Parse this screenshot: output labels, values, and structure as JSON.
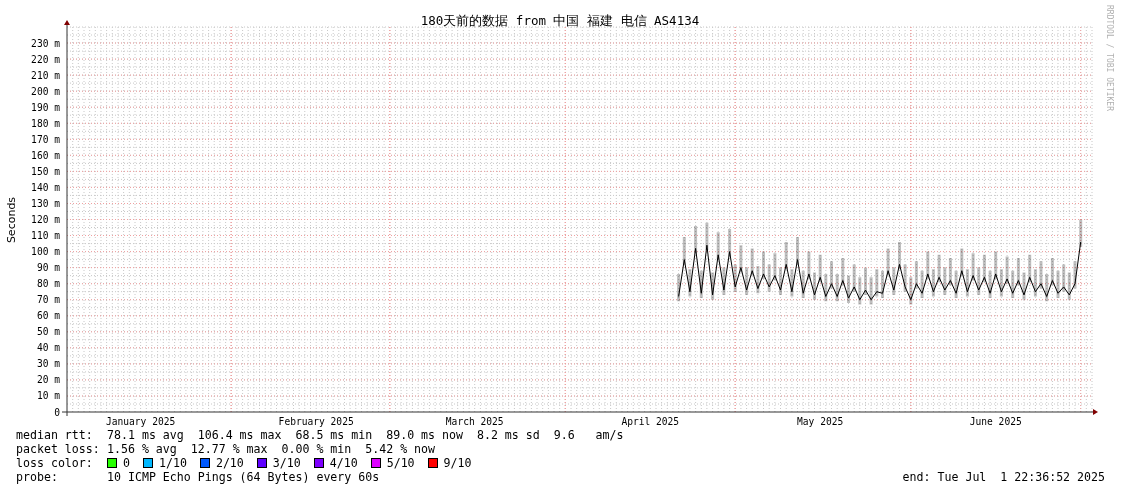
{
  "graph": {
    "credit": "RRDTOOL / TOBI OETIKER",
    "chart_data": {
      "type": "line",
      "title": "180天前的数据 from 中国 福建 电信 AS4134",
      "ylabel": "Seconds",
      "grid": true,
      "xlim": [
        "2025-01-03",
        "2025-07-03"
      ],
      "ylim": [
        0,
        240
      ],
      "xticks": [
        {
          "value": "2025-01-16",
          "label": "January 2025"
        },
        {
          "value": "2025-02-16",
          "label": "February 2025"
        },
        {
          "value": "2025-03-16",
          "label": "March 2025"
        },
        {
          "value": "2025-04-16",
          "label": "April 2025"
        },
        {
          "value": "2025-05-16",
          "label": "May 2025"
        },
        {
          "value": "2025-06-16",
          "label": "June 2025"
        }
      ],
      "yticks": [
        {
          "value": 0,
          "label": "0"
        },
        {
          "value": 10,
          "label": "10 m"
        },
        {
          "value": 20,
          "label": "20 m"
        },
        {
          "value": 30,
          "label": "30 m"
        },
        {
          "value": 40,
          "label": "40 m"
        },
        {
          "value": 50,
          "label": "50 m"
        },
        {
          "value": 60,
          "label": "60 m"
        },
        {
          "value": 70,
          "label": "70 m"
        },
        {
          "value": 80,
          "label": "80 m"
        },
        {
          "value": 90,
          "label": "90 m"
        },
        {
          "value": 100,
          "label": "100 m"
        },
        {
          "value": 110,
          "label": "110 m"
        },
        {
          "value": 120,
          "label": "120 m"
        },
        {
          "value": 130,
          "label": "130 m"
        },
        {
          "value": 140,
          "label": "140 m"
        },
        {
          "value": 150,
          "label": "150 m"
        },
        {
          "value": 160,
          "label": "160 m"
        },
        {
          "value": 170,
          "label": "170 m"
        },
        {
          "value": 180,
          "label": "180 m"
        },
        {
          "value": 190,
          "label": "190 m"
        },
        {
          "value": 200,
          "label": "200 m"
        },
        {
          "value": 210,
          "label": "210 m"
        },
        {
          "value": 220,
          "label": "220 m"
        },
        {
          "value": 230,
          "label": "230 m"
        }
      ],
      "x": [
        "2025-04-21",
        "2025-04-22",
        "2025-04-23",
        "2025-04-24",
        "2025-04-25",
        "2025-04-26",
        "2025-04-27",
        "2025-04-28",
        "2025-04-29",
        "2025-04-30",
        "2025-05-01",
        "2025-05-02",
        "2025-05-03",
        "2025-05-04",
        "2025-05-05",
        "2025-05-06",
        "2025-05-07",
        "2025-05-08",
        "2025-05-09",
        "2025-05-10",
        "2025-05-11",
        "2025-05-12",
        "2025-05-13",
        "2025-05-14",
        "2025-05-15",
        "2025-05-16",
        "2025-05-17",
        "2025-05-18",
        "2025-05-19",
        "2025-05-20",
        "2025-05-21",
        "2025-05-22",
        "2025-05-23",
        "2025-05-24",
        "2025-05-25",
        "2025-05-26",
        "2025-05-27",
        "2025-05-28",
        "2025-05-29",
        "2025-05-30",
        "2025-05-31",
        "2025-06-01",
        "2025-06-02",
        "2025-06-03",
        "2025-06-04",
        "2025-06-05",
        "2025-06-06",
        "2025-06-07",
        "2025-06-08",
        "2025-06-09",
        "2025-06-10",
        "2025-06-11",
        "2025-06-12",
        "2025-06-13",
        "2025-06-14",
        "2025-06-15",
        "2025-06-16",
        "2025-06-17",
        "2025-06-18",
        "2025-06-19",
        "2025-06-20",
        "2025-06-21",
        "2025-06-22",
        "2025-06-23",
        "2025-06-24",
        "2025-06-25",
        "2025-06-26",
        "2025-06-27",
        "2025-06-28",
        "2025-06-29",
        "2025-06-30",
        "2025-07-01"
      ],
      "series": [
        {
          "color": "#000000",
          "values": [
            72,
            95,
            75,
            102,
            74,
            104,
            73,
            98,
            76,
            100,
            78,
            90,
            76,
            88,
            77,
            86,
            78,
            85,
            76,
            92,
            75,
            95,
            74,
            86,
            73,
            84,
            72,
            80,
            72,
            82,
            71,
            78,
            70,
            76,
            70,
            75,
            74,
            88,
            76,
            92,
            78,
            70,
            80,
            74,
            86,
            75,
            84,
            76,
            82,
            74,
            88,
            75,
            85,
            76,
            84,
            74,
            86,
            75,
            83,
            74,
            82,
            73,
            84,
            75,
            80,
            72,
            82,
            74,
            78,
            73,
            80,
            106
          ]
        }
      ]
    }
  },
  "stats": [
    {
      "label": "median rtt:",
      "value": "78.1 ms avg  106.4 ms max  68.5 ms min  89.0 ms now  8.2 ms sd  9.6   am/s"
    },
    {
      "label": "packet loss:",
      "value": "1.56 % avg  12.77 % max  0.00 % min  5.42 % now"
    }
  ],
  "loss_color": {
    "label": "loss color:",
    "items": [
      {
        "label": "0",
        "color": "#26ff00"
      },
      {
        "label": "1/10",
        "color": "#00b8ff"
      },
      {
        "label": "2/10",
        "color": "#0059ff"
      },
      {
        "label": "3/10",
        "color": "#5e00ff"
      },
      {
        "label": "4/10",
        "color": "#7e00ff"
      },
      {
        "label": "5/10",
        "color": "#dd00ff"
      },
      {
        "label": "9/10",
        "color": "#ff0000"
      }
    ]
  },
  "probe": {
    "label": "probe:",
    "value": "10 ICMP Echo Pings (64 Bytes) every 60s"
  },
  "end": "end: Tue Jul  1 22:36:52 2025"
}
